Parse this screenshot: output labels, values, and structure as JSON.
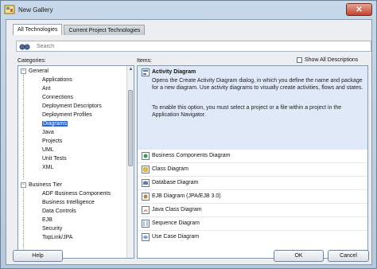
{
  "window": {
    "title": "New Gallery"
  },
  "tabs": [
    {
      "label": "All Technologies",
      "active": true
    },
    {
      "label": "Current Project Technologies",
      "active": false
    }
  ],
  "search": {
    "placeholder": "Search",
    "icon": "binoculars-icon"
  },
  "categories_label": "Categories:",
  "items_label": "Items:",
  "show_all_label": "Show All Descriptions",
  "tree": [
    {
      "label": "General",
      "level": 0,
      "expanded": true
    },
    {
      "label": "Applications",
      "level": 1
    },
    {
      "label": "Ant",
      "level": 1
    },
    {
      "label": "Connections",
      "level": 1
    },
    {
      "label": "Deployment Descriptors",
      "level": 1
    },
    {
      "label": "Deployment Profiles",
      "level": 1
    },
    {
      "label": "Diagrams",
      "level": 1,
      "selected": true
    },
    {
      "label": "Java",
      "level": 1
    },
    {
      "label": "Projects",
      "level": 1
    },
    {
      "label": "UML",
      "level": 1
    },
    {
      "label": "Unit Tests",
      "level": 1
    },
    {
      "label": "XML",
      "level": 1
    },
    {
      "label": "Business Tier",
      "level": 0,
      "expanded": true
    },
    {
      "label": "ADF Business Components",
      "level": 1
    },
    {
      "label": "Business Intelligence",
      "level": 1
    },
    {
      "label": "Data Controls",
      "level": 1
    },
    {
      "label": "EJB",
      "level": 1
    },
    {
      "label": "Security",
      "level": 1
    },
    {
      "label": "TopLink/JPA",
      "level": 1
    }
  ],
  "selected_item": {
    "title": "Activity Diagram",
    "desc1": "Opens the Create Activity Diagram dialog, in which you define the name and package for a new diagram. Use activity diagrams to visually create activities, flows and states.",
    "desc2": "To enable this option, you must select a project or a file within a project in the Application Navigator."
  },
  "items": [
    "Business Components Diagram",
    "Class Diagram",
    "Database Diagram",
    "EJB Diagram (JPA/EJB 3.0)",
    "Java Class Diagram",
    "Sequence Diagram",
    "Use Case Diagram"
  ],
  "buttons": {
    "help": "Help",
    "ok": "OK",
    "cancel": "Cancel"
  }
}
